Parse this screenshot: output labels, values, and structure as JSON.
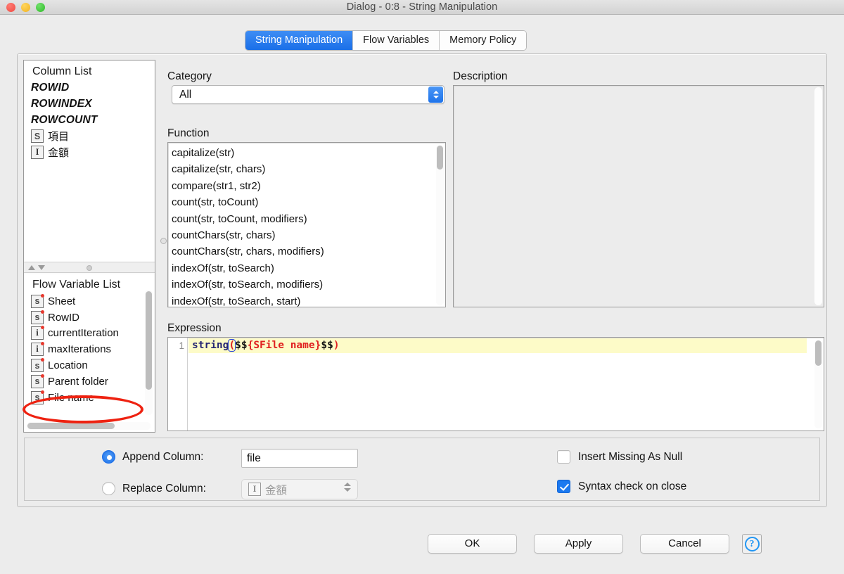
{
  "window": {
    "title": "Dialog - 0:8 - String Manipulation",
    "traffic_lights": [
      "close-red",
      "minimize-yellow",
      "maximize-green"
    ]
  },
  "tabs": [
    {
      "label": "String Manipulation",
      "active": true
    },
    {
      "label": "Flow Variables",
      "active": false
    },
    {
      "label": "Memory Policy",
      "active": false
    }
  ],
  "column_list": {
    "title": "Column List",
    "items": [
      {
        "label": "ROWID",
        "style": "italic",
        "icon": ""
      },
      {
        "label": "ROWINDEX",
        "style": "italic",
        "icon": ""
      },
      {
        "label": "ROWCOUNT",
        "style": "italic",
        "icon": ""
      },
      {
        "label": "項目",
        "style": "normal",
        "icon": "S"
      },
      {
        "label": "金額",
        "style": "normal",
        "icon": "I"
      }
    ]
  },
  "flow_variable_list": {
    "title": "Flow Variable List",
    "items": [
      {
        "label": "Sheet",
        "icon": "s"
      },
      {
        "label": "RowID",
        "icon": "s"
      },
      {
        "label": "currentIteration",
        "icon": "i"
      },
      {
        "label": "maxIterations",
        "icon": "i"
      },
      {
        "label": "Location",
        "icon": "s"
      },
      {
        "label": "Parent folder",
        "icon": "s"
      },
      {
        "label": "File name",
        "icon": "s",
        "highlighted": true
      }
    ]
  },
  "category": {
    "label": "Category",
    "selected": "All"
  },
  "function": {
    "label": "Function",
    "items": [
      "capitalize(str)",
      "capitalize(str, chars)",
      "compare(str1, str2)",
      "count(str, toCount)",
      "count(str, toCount, modifiers)",
      "countChars(str, chars)",
      "countChars(str, chars, modifiers)",
      "indexOf(str, toSearch)",
      "indexOf(str, toSearch, modifiers)",
      "indexOf(str, toSearch, start)"
    ]
  },
  "description": {
    "label": "Description",
    "content": ""
  },
  "expression": {
    "label": "Expression",
    "line_number": "1",
    "tokens": [
      {
        "text": "string",
        "kind": "function"
      },
      {
        "text": "(",
        "kind": "paren-highlighted"
      },
      {
        "text": "$$",
        "kind": "black"
      },
      {
        "text": "{SFile name}",
        "kind": "red"
      },
      {
        "text": "$$",
        "kind": "black"
      },
      {
        "text": ")",
        "kind": "red"
      }
    ],
    "full_text": "string($$${SFile name}$$)"
  },
  "options": {
    "append_column": {
      "label": "Append Column:",
      "selected": true,
      "value": "file"
    },
    "replace_column": {
      "label": "Replace Column:",
      "selected": false,
      "value": "金額",
      "icon": "I"
    },
    "insert_missing_as_null": {
      "label": "Insert Missing As Null",
      "checked": false
    },
    "syntax_check_on_close": {
      "label": "Syntax check on close",
      "checked": true
    }
  },
  "footer": {
    "ok": "OK",
    "apply": "Apply",
    "cancel": "Cancel",
    "help": "?"
  },
  "colors": {
    "accent_blue": "#1b6ee8",
    "tab_active": "#2a7df0",
    "annotation_red": "#ee2211",
    "expression_bg": "#fdfbc8",
    "token_function": "#262673",
    "token_red": "#e02020"
  }
}
